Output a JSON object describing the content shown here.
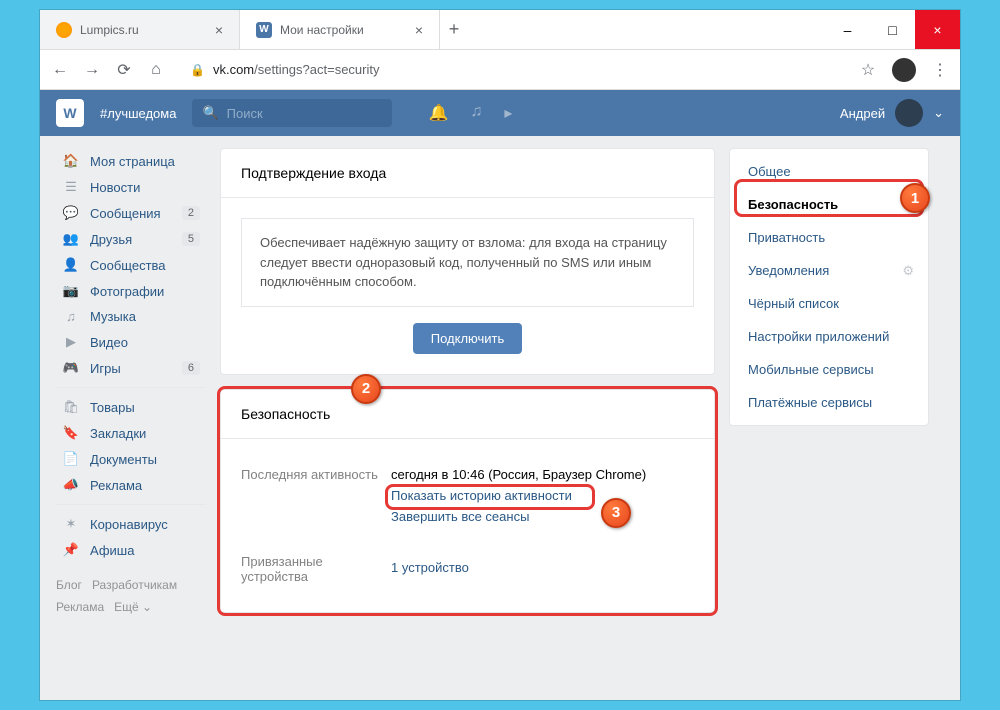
{
  "browser": {
    "tabs": [
      {
        "title": "Lumpics.ru"
      },
      {
        "title": "Мои настройки"
      }
    ],
    "url_domain": "vk.com",
    "url_path": "/settings?act=security"
  },
  "vk": {
    "hashtag": "#лучшедома",
    "search_placeholder": "Поиск",
    "username": "Андрей"
  },
  "leftnav": {
    "items": [
      {
        "icon": "🏠",
        "label": "Моя страница"
      },
      {
        "icon": "☰",
        "label": "Новости"
      },
      {
        "icon": "💬",
        "label": "Сообщения",
        "badge": "2"
      },
      {
        "icon": "👥",
        "label": "Друзья",
        "badge": "5"
      },
      {
        "icon": "👤",
        "label": "Сообщества"
      },
      {
        "icon": "📷",
        "label": "Фотографии"
      },
      {
        "icon": "♫",
        "label": "Музыка"
      },
      {
        "icon": "▶",
        "label": "Видео"
      },
      {
        "icon": "🎮",
        "label": "Игры",
        "badge": "6"
      }
    ],
    "items2": [
      {
        "icon": "🛍",
        "label": "Товары"
      },
      {
        "icon": "🔖",
        "label": "Закладки"
      },
      {
        "icon": "📄",
        "label": "Документы"
      },
      {
        "icon": "📣",
        "label": "Реклама"
      }
    ],
    "items3": [
      {
        "icon": "✶",
        "label": "Коронавирус"
      },
      {
        "icon": "📌",
        "label": "Афиша"
      }
    ]
  },
  "footer": {
    "blog": "Блог",
    "devs": "Разработчикам",
    "ads": "Реклама",
    "more": "Ещё ⌄"
  },
  "login_confirm": {
    "title": "Подтверждение входа",
    "desc": "Обеспечивает надёжную защиту от взлома: для входа на страницу следует ввести одноразовый код, полученный по SMS или иным подключённым способом.",
    "button": "Подключить"
  },
  "security": {
    "title": "Безопасность",
    "last_activity_label": "Последняя активность",
    "last_activity_value": "сегодня в 10:46 (Россия, Браузер Chrome)",
    "show_history": "Показать историю активности",
    "end_sessions": "Завершить все сеансы",
    "devices_label": "Привязанные устройства",
    "devices_value": "1 устройство"
  },
  "rightnav": {
    "items": [
      "Общее",
      "Безопасность",
      "Приватность",
      "Уведомления",
      "Чёрный список",
      "Настройки приложений",
      "Мобильные сервисы",
      "Платёжные сервисы"
    ]
  },
  "callouts": {
    "c1": "1",
    "c2": "2",
    "c3": "3"
  }
}
